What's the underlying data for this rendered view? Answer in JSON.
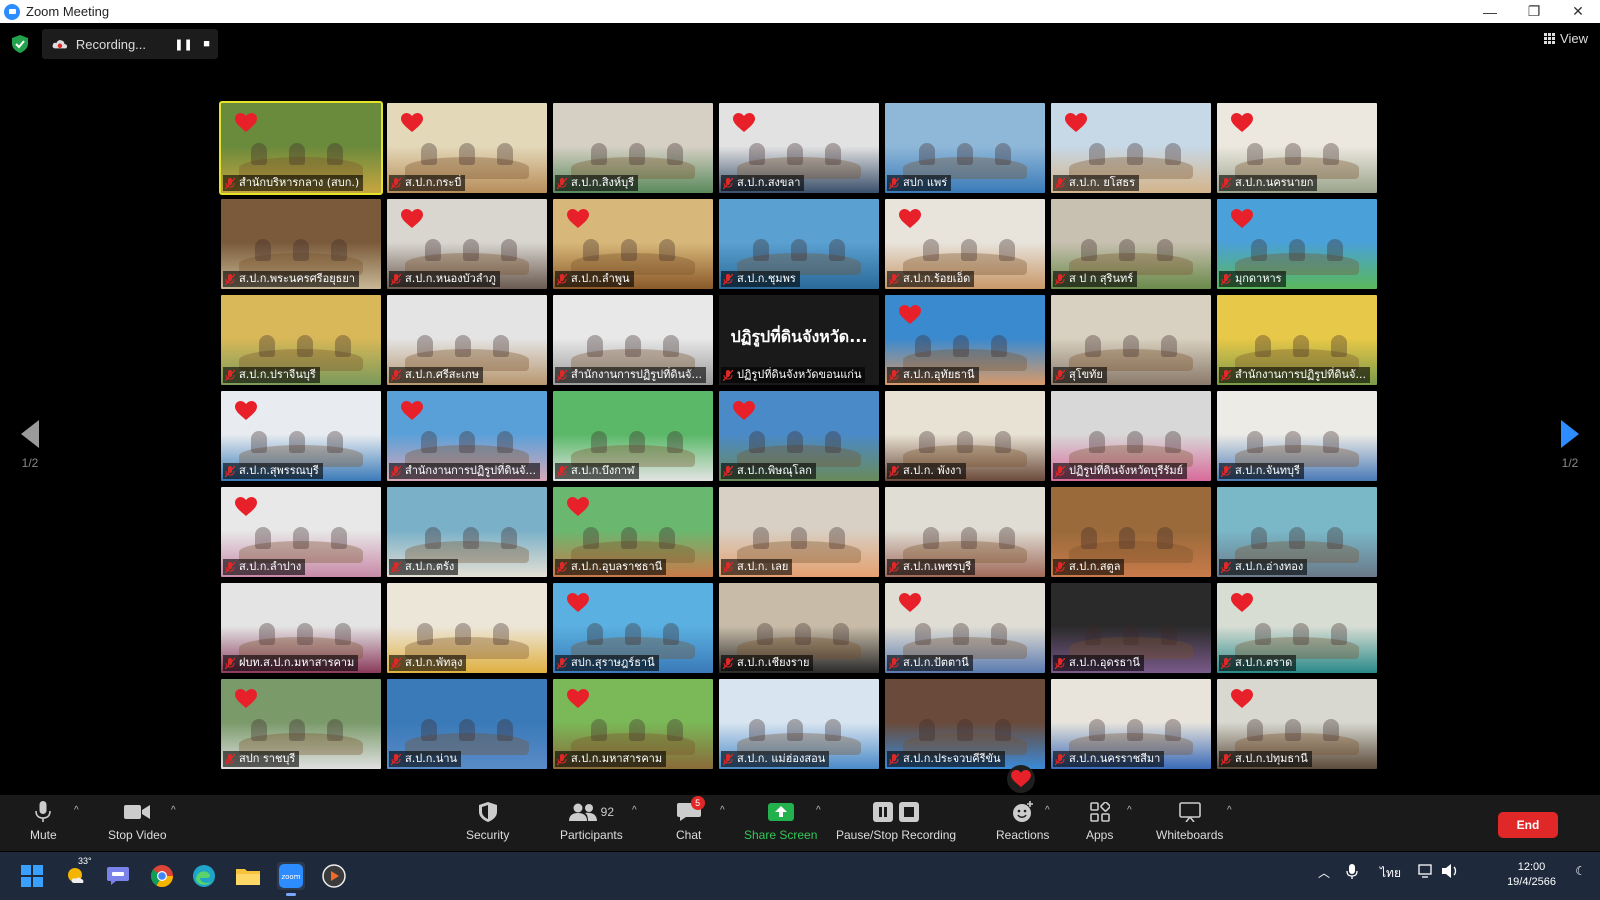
{
  "window": {
    "title": "Zoom Meeting",
    "minimize": "—",
    "maximize": "❐",
    "close": "✕"
  },
  "topbar": {
    "recording_label": "Recording...",
    "pause": "❚❚",
    "stop": "■",
    "view_label": "View"
  },
  "pager": {
    "label": "1/2"
  },
  "tiles": [
    {
      "name": "สำนักบริหารกลาง (สบก.)",
      "heart": true,
      "active": true,
      "c1": "#6a8a3c",
      "c2": "#c8a640"
    },
    {
      "name": "ส.ป.ก.กระบี่",
      "heart": true,
      "c1": "#e3d8b8",
      "c2": "#b88d5a"
    },
    {
      "name": "ส.ป.ก.สิงห์บุรี",
      "heart": false,
      "c1": "#d6d0c4",
      "c2": "#5a8a5c"
    },
    {
      "name": "ส.ป.ก.สงขลา",
      "heart": true,
      "c1": "#e2e2e2",
      "c2": "#3a4f6a"
    },
    {
      "name": "สปก แพร่",
      "heart": false,
      "c1": "#8fb7d8",
      "c2": "#3a7ab8"
    },
    {
      "name": "ส.ป.ก. ยโสธร",
      "heart": true,
      "c1": "#c7d8e6",
      "c2": "#d4b48a"
    },
    {
      "name": "ส.ป.ก.นครนายก",
      "heart": true,
      "c1": "#ece8df",
      "c2": "#9aa38c"
    },
    {
      "name": "ส.ป.ก.พระนครศรีอยุธยา",
      "heart": false,
      "c1": "#7a5a3a",
      "c2": "#c8b896"
    },
    {
      "name": "ส.ป.ก.หนองบัวลำภู",
      "heart": true,
      "c1": "#d9d6d0",
      "c2": "#6a5a50"
    },
    {
      "name": "ส.ป.ก.ลำพูน",
      "heart": true,
      "c1": "#d8b87a",
      "c2": "#8a5a2a"
    },
    {
      "name": "ส.ป.ก.ชุมพร",
      "heart": false,
      "c1": "#5aa0d0",
      "c2": "#2a6a9a"
    },
    {
      "name": "ส.ป.ก.ร้อยเอ็ด",
      "heart": true,
      "c1": "#e8e4dc",
      "c2": "#c89868"
    },
    {
      "name": "ส ป ก สุรินทร์",
      "heart": false,
      "c1": "#c8c0b0",
      "c2": "#6a8a4a"
    },
    {
      "name": "มุกดาหาร",
      "heart": true,
      "c1": "#4aa0d8",
      "c2": "#5ab85a"
    },
    {
      "name": "ส.ป.ก.ปราจีนบุรี",
      "heart": false,
      "c1": "#d8b858",
      "c2": "#7a9a5a"
    },
    {
      "name": "ส.ป.ก.ศรีสะเกษ",
      "heart": false,
      "c1": "#e4e4e4",
      "c2": "#b89870"
    },
    {
      "name": "สำนักงานการปฏิรูปที่ดินจั...",
      "heart": false,
      "c1": "#e8e8e8",
      "c2": "#9a9a9a"
    },
    {
      "name": "ปฏิรูปที่ดินจังหวัดขอนแก่น",
      "heart": false,
      "blank": true,
      "big": "ปฏิรูปที่ดินจังหวัด...",
      "c1": "#1a1a1a",
      "c2": "#1a1a1a"
    },
    {
      "name": "ส.ป.ก.อุทัยธานี",
      "heart": true,
      "c1": "#3a8ad0",
      "c2": "#d89a6a"
    },
    {
      "name": "สุโขทัย",
      "heart": false,
      "c1": "#d8d0c0",
      "c2": "#8a7a6a"
    },
    {
      "name": "สำนักงานการปฏิรูปที่ดินจั...",
      "heart": false,
      "c1": "#e8c848",
      "c2": "#7a9a4a"
    },
    {
      "name": "ส.ป.ก.สุพรรณบุรี",
      "heart": true,
      "c1": "#e8ecf0",
      "c2": "#3a7ab8"
    },
    {
      "name": "สำนักงานการปฏิรูปที่ดินจั...",
      "heart": true,
      "c1": "#5aa0d8",
      "c2": "#d8a8b8"
    },
    {
      "name": "ส.ป.ก.บึงกาฬ",
      "heart": false,
      "c1": "#5ab868",
      "c2": "#e4e4e4"
    },
    {
      "name": "ส.ป.ก.พิษณุโลก",
      "heart": true,
      "c1": "#4a8ac8",
      "c2": "#6a8a5a"
    },
    {
      "name": "ส.ป.ก. พังงา",
      "heart": false,
      "c1": "#e8e2d4",
      "c2": "#6a4a3a"
    },
    {
      "name": "ปฏิรูปที่ดินจังหวัดบุรีรัมย์",
      "heart": false,
      "c1": "#d8d8d8",
      "c2": "#d86a9a"
    },
    {
      "name": "ส.ป.ก.จันทบุรี",
      "heart": false,
      "c1": "#ecebe6",
      "c2": "#4a7ab8"
    },
    {
      "name": "ส.ป.ก.ลำปาง",
      "heart": true,
      "c1": "#e8e8e8",
      "c2": "#c88aa8"
    },
    {
      "name": "ส.ป.ก.ตรัง",
      "heart": false,
      "c1": "#7ab0c8",
      "c2": "#e4e0d4"
    },
    {
      "name": "ส.ป.ก.อุบลราชธานี",
      "heart": true,
      "c1": "#6ab870",
      "c2": "#c87a4a"
    },
    {
      "name": "ส.ป.ก. เลย",
      "heart": false,
      "c1": "#d8d0c4",
      "c2": "#e4a070"
    },
    {
      "name": "ส.ป.ก.เพชรบุรี",
      "heart": false,
      "c1": "#e0ddd4",
      "c2": "#a06a5a"
    },
    {
      "name": "ส.ป.ก.สตูล",
      "heart": false,
      "c1": "#9a6a3a",
      "c2": "#c87a4a"
    },
    {
      "name": "ส.ป.ก.อ่างทอง",
      "heart": false,
      "c1": "#7ab8c8",
      "c2": "#6a7a8a"
    },
    {
      "name": "ฝบท.ส.ป.ก.มหาสารคาม",
      "heart": false,
      "c1": "#e4e4e4",
      "c2": "#8a3a5a"
    },
    {
      "name": "ส.ป.ก.พัทลุง",
      "heart": false,
      "c1": "#ece6d8",
      "c2": "#e0b040"
    },
    {
      "name": "สปก.สุราษฎร์ธานี",
      "heart": true,
      "c1": "#5ab0e0",
      "c2": "#3a7ab8"
    },
    {
      "name": "ส.ป.ก.เชียงราย",
      "heart": false,
      "c1": "#c8bca8",
      "c2": "#2a2a2a"
    },
    {
      "name": "ส.ป.ก.ปัตตานี",
      "heart": true,
      "c1": "#e0ddd4",
      "c2": "#5a7ab0"
    },
    {
      "name": "ส.ป.ก.อุดรธานี",
      "heart": false,
      "c1": "#2a2a2a",
      "c2": "#7a5a8a"
    },
    {
      "name": "ส.ป.ก.ตราด",
      "heart": true,
      "c1": "#d8ddd4",
      "c2": "#2a8a8a"
    },
    {
      "name": "สปก ราชบุรี",
      "heart": true,
      "c1": "#7a9a6a",
      "c2": "#e0e0e0"
    },
    {
      "name": "ส.ป.ก.น่าน",
      "heart": false,
      "c1": "#3a7ab8",
      "c2": "#5a8ac8"
    },
    {
      "name": "ส.ป.ก.มหาสารคาม",
      "heart": true,
      "c1": "#7ab858",
      "c2": "#8a6a3a"
    },
    {
      "name": "ส.ป.ก. แม่ฮ่องสอน",
      "heart": false,
      "c1": "#d8e4f0",
      "c2": "#4a8ac8"
    },
    {
      "name": "ส.ป.ก.ประจวบคีรีขัน",
      "heart": false,
      "c1": "#6a4a3a",
      "c2": "#3a8ad8"
    },
    {
      "name": "ส.ป.ก.นครราชสีมา",
      "heart": false,
      "c1": "#e8e4dc",
      "c2": "#3a6ab8"
    },
    {
      "name": "ส.ป.ก.ปทุมธานี",
      "heart": true,
      "c1": "#d8d8d0",
      "c2": "#5a4a3a"
    }
  ],
  "toolbar": {
    "mute": "Mute",
    "stop_video": "Stop Video",
    "security": "Security",
    "participants": "Participants",
    "participants_count": "92",
    "chat": "Chat",
    "chat_badge": "5",
    "share_screen": "Share Screen",
    "pause_stop_recording": "Pause/Stop Recording",
    "reactions": "Reactions",
    "apps": "Apps",
    "whiteboards": "Whiteboards",
    "end": "End"
  },
  "taskbar": {
    "weather_temp": "33°",
    "lang": "ไทย",
    "time": "12:00",
    "date": "19/4/2566",
    "zoom_app_label": "zoom"
  }
}
